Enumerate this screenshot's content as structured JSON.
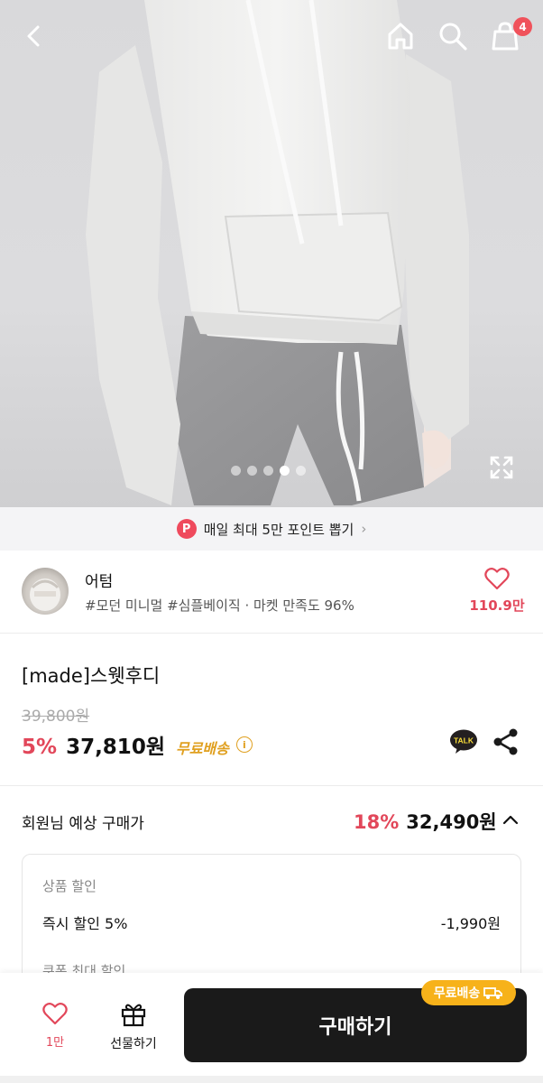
{
  "header": {
    "back_icon": "chevron-left-icon",
    "home_icon": "home-icon",
    "search_icon": "search-icon",
    "cart_icon": "shopping-bag-icon",
    "cart_count": "4"
  },
  "gallery": {
    "image_count": 5,
    "active_index": 4,
    "expand_icon": "expand-icon"
  },
  "point_banner": {
    "badge": "P",
    "text": "매일 최대 5만 포인트 뽑기",
    "chevron": "›"
  },
  "store": {
    "name": "어텀",
    "tags": "#모던 미니멀 #심플베이직 · 마켓 만족도 96%",
    "like_count": "110.9만"
  },
  "product": {
    "title": "[made]스웻후디",
    "original_price": "39,800원",
    "discount_rate": "5%",
    "sale_price": "37,810원",
    "shipping": "무료배송",
    "info_glyph": "i"
  },
  "member_price": {
    "label": "회원님 예상 구매가",
    "discount_rate": "18%",
    "price": "32,490원"
  },
  "discount_detail": {
    "section_title": "상품 할인",
    "instant_label": "즉시 할인 5%",
    "instant_value": "-1,990원",
    "coupon_title": "쿠폰 최대 할인"
  },
  "bottom_bar": {
    "like_count": "1만",
    "gift_label": "선물하기",
    "buy_label": "구매하기",
    "ship_tag": "무료배송"
  },
  "colors": {
    "accent_red": "#e2475a",
    "shipping_gold": "#e0a020",
    "buy_button": "#1a1a1a",
    "ship_tag": "#f7b21a"
  }
}
